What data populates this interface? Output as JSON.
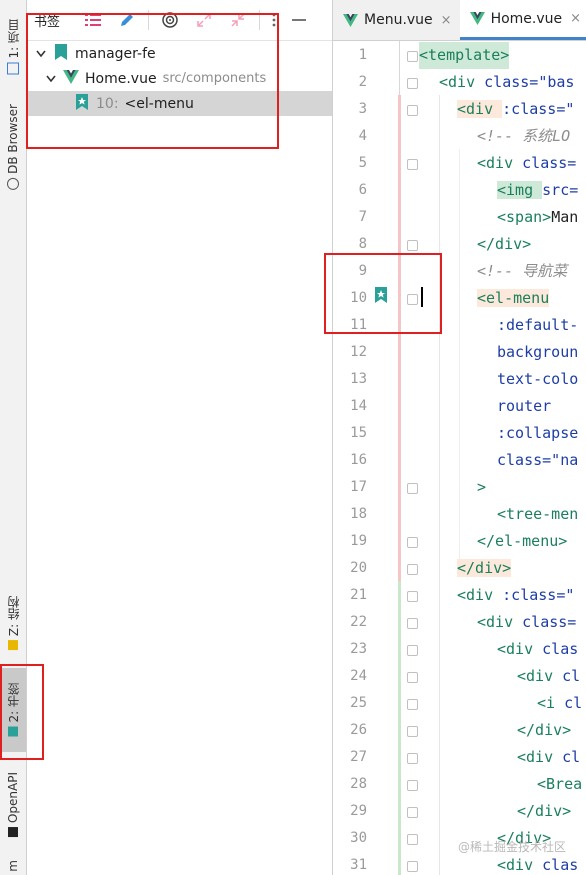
{
  "left_strip": {
    "tabs": [
      {
        "label": "1: 项目",
        "icon": "project-icon"
      },
      {
        "label": "DB Browser",
        "icon": "db-icon"
      },
      {
        "label": "Z: 结构",
        "icon": "structure-icon"
      },
      {
        "label": "2: 书签",
        "icon": "bookmark-icon"
      },
      {
        "label": "OpenAPI",
        "icon": "api-icon"
      },
      {
        "label": "m",
        "icon": ""
      }
    ]
  },
  "panel": {
    "title": "书签",
    "tree": {
      "root": "manager-fe",
      "file": "Home.vue",
      "file_path": "src/components",
      "bookmark_line": "10:",
      "bookmark_text": "<el-menu"
    }
  },
  "editor": {
    "tabs": [
      {
        "label": "Menu.vue",
        "close": "×"
      },
      {
        "label": "Home.vue",
        "close": "×"
      }
    ],
    "lines": [
      "1",
      "2",
      "3",
      "4",
      "5",
      "6",
      "7",
      "8",
      "9",
      "10",
      "11",
      "12",
      "13",
      "14",
      "15",
      "16",
      "17",
      "18",
      "19",
      "20",
      "21",
      "22",
      "23",
      "24",
      "25",
      "26",
      "27",
      "28",
      "29",
      "30",
      "31"
    ]
  },
  "code": {
    "l1": "<template>",
    "l2a": "<div ",
    "l2b": "class=\"bas",
    "l3a": "<div ",
    "l3b": ":class=\"",
    "l4": "<!-- 系统LO",
    "l5a": "<div ",
    "l5b": "class=",
    "l6a": "<img ",
    "l6b": "src=",
    "l7a": "<span>",
    "l7b": "Man",
    "l8": "</div>",
    "l9": "<!-- 导航菜",
    "l10": "<el-menu",
    "l11": ":default-",
    "l12": "backgroun",
    "l13": "text-colo",
    "l14": "router",
    "l15": ":collapse",
    "l16": "class=\"na",
    "l17": ">",
    "l18": "<tree-men",
    "l19": "</el-menu>",
    "l20": "</div>",
    "l21a": "<div ",
    "l21b": ":class=\"",
    "l22a": "<div ",
    "l22b": "class=",
    "l23a": "<div ",
    "l23b": "clas",
    "l24a": "<div ",
    "l24b": "cl",
    "l25a": "<i ",
    "l25b": "cl",
    "l26": "</div>",
    "l27a": "<div ",
    "l27b": "cl",
    "l28": "<Brea",
    "l29": "</div>",
    "l30": "</div>",
    "l31a": "<div ",
    "l31b": "clas"
  },
  "watermark": "@稀土掘金技术社区",
  "colors": {
    "tag": "#1a7f5c",
    "attr": "#1e3ea6",
    "comment": "#8d8d8d",
    "annotation": "#e02020",
    "bookmark": "#2aa198"
  }
}
